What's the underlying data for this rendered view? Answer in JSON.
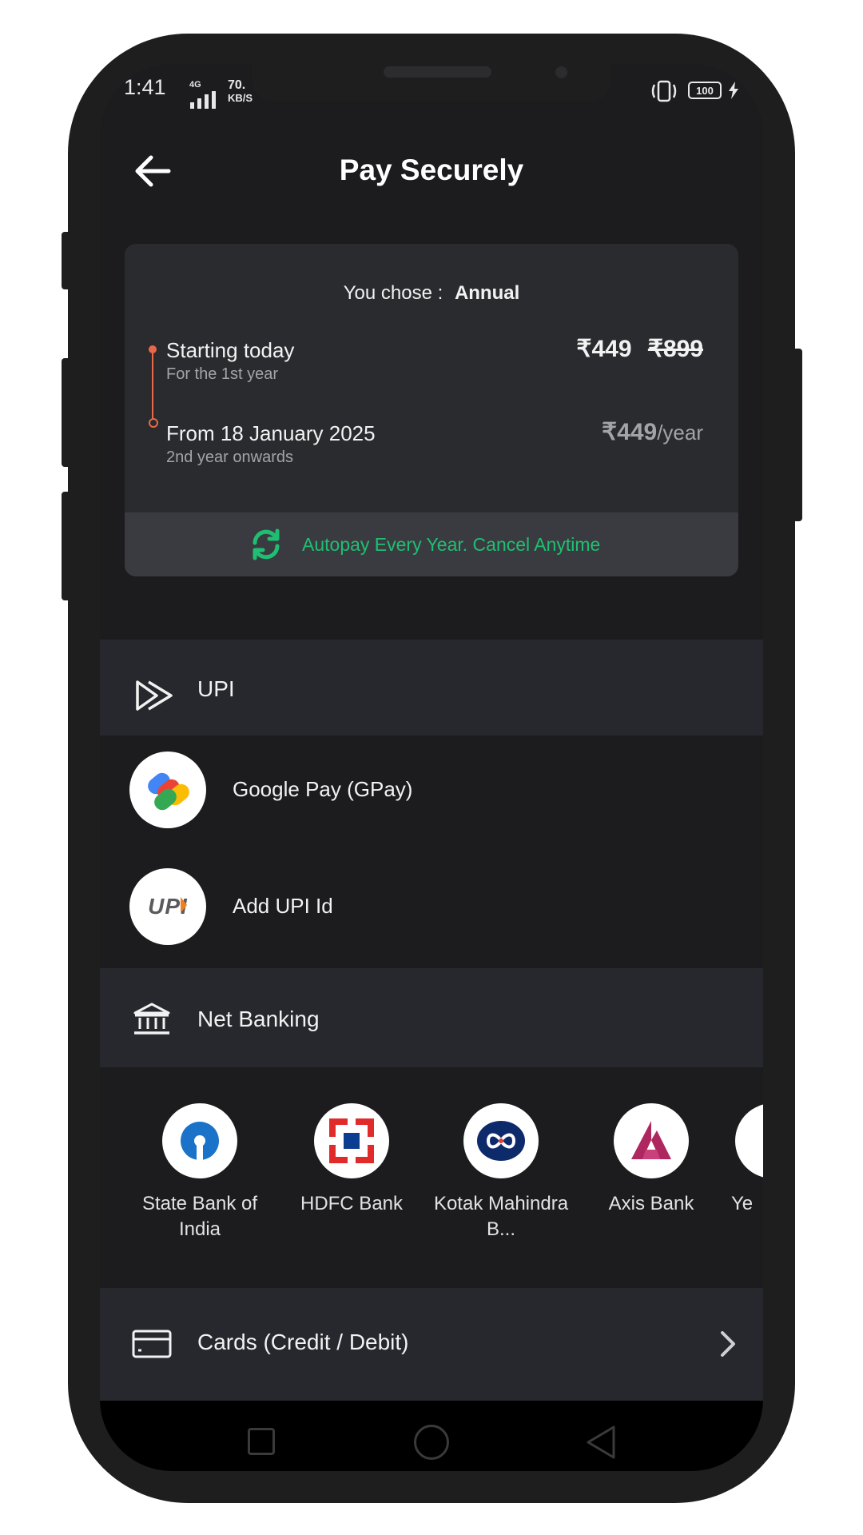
{
  "status_bar": {
    "time": "1:41",
    "network": "4G",
    "speed_value": "70.",
    "speed_unit": "KB/S",
    "battery": "100"
  },
  "header": {
    "title": "Pay Securely"
  },
  "plan": {
    "chose_label": "You chose :",
    "chose_value": "Annual",
    "today_title": "Starting today",
    "today_subtitle": "For the 1st year",
    "today_price": "₹449",
    "today_original_price": "₹899",
    "future_title": "From 18 January 2025",
    "future_subtitle": "2nd year onwards",
    "future_price": "₹449",
    "future_period": "/year",
    "autopay_text": "Autopay Every Year. Cancel Anytime"
  },
  "upi": {
    "section_label": "UPI",
    "options": [
      {
        "label": "Google Pay (GPay)"
      },
      {
        "label": "Add UPI Id"
      }
    ],
    "upi_logo_text": "UPI"
  },
  "net_banking": {
    "section_label": "Net Banking",
    "banks": [
      {
        "name": "State Bank of India"
      },
      {
        "name": "HDFC Bank"
      },
      {
        "name": "Kotak Mahindra B..."
      },
      {
        "name": "Axis Bank"
      },
      {
        "name": "Ye"
      }
    ]
  },
  "cards": {
    "label": "Cards (Credit / Debit)"
  },
  "colors": {
    "accent_green": "#1fbf73",
    "timeline_orange": "#e8694a",
    "background": "#1c1c1e",
    "band": "#27282d"
  },
  "icons": [
    "back-arrow-icon",
    "refresh-icon",
    "upi-play-icon",
    "bank-icon",
    "card-icon",
    "chevron-right-icon",
    "vibrate-icon",
    "battery-icon",
    "charging-icon",
    "signal-icon"
  ]
}
